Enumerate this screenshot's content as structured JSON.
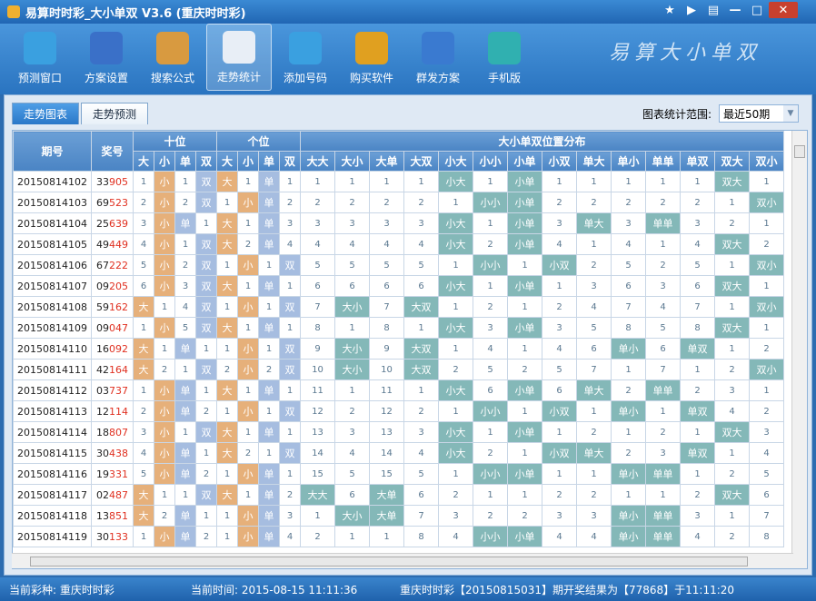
{
  "window": {
    "title": "易算时时彩_大小单双 V3.6 (重庆时时彩)"
  },
  "toolbar": {
    "items": [
      {
        "label": "预测窗口",
        "icon": "cloud-icon",
        "color": "#3aa0e0"
      },
      {
        "label": "方案设置",
        "icon": "settings-panel-icon",
        "color": "#3a70c8"
      },
      {
        "label": "搜索公式",
        "icon": "search-doc-icon",
        "color": "#d89a40"
      },
      {
        "label": "走势统计",
        "icon": "trend-chart-icon",
        "color": "#e8eef6"
      },
      {
        "label": "添加号码",
        "icon": "folder-add-icon",
        "color": "#3aa0e0"
      },
      {
        "label": "购买软件",
        "icon": "key-icon",
        "color": "#e0a020"
      },
      {
        "label": "群发方案",
        "icon": "users-icon",
        "color": "#3a7ad0"
      },
      {
        "label": "手机版",
        "icon": "mobile-icon",
        "color": "#30b0b0"
      }
    ],
    "brand": "易算大小单双"
  },
  "tabs": [
    "走势图表",
    "走势预测"
  ],
  "range": {
    "label": "图表统计范围:",
    "value": "最近50期"
  },
  "table": {
    "headers": {
      "period": "期号",
      "number": "奖号",
      "tens": "十位",
      "units": "个位",
      "dist": "大小单双位置分布"
    },
    "sub": [
      "大",
      "小",
      "单",
      "双",
      "大",
      "小",
      "单",
      "双"
    ],
    "dist_cols": [
      "大大",
      "大小",
      "大单",
      "大双",
      "小大",
      "小小",
      "小单",
      "小双",
      "单大",
      "单小",
      "单单",
      "单双",
      "双大",
      "双小"
    ],
    "rows": [
      {
        "p": "20150814102",
        "n": "33905",
        "t": [
          "1",
          "小",
          "1",
          "双"
        ],
        "u": [
          "大",
          "1",
          "单",
          "1"
        ],
        "d": [
          "1",
          "1",
          "1",
          "1",
          "小大",
          "1",
          "小单",
          "1",
          "1",
          "1",
          "1",
          "1",
          "双大",
          "1"
        ]
      },
      {
        "p": "20150814103",
        "n": "69523",
        "t": [
          "2",
          "小",
          "2",
          "双"
        ],
        "u": [
          "1",
          "小",
          "单",
          "2"
        ],
        "d": [
          "2",
          "2",
          "2",
          "2",
          "1",
          "小小",
          "小单",
          "2",
          "2",
          "2",
          "2",
          "2",
          "1",
          "双小"
        ]
      },
      {
        "p": "20150814104",
        "n": "25639",
        "t": [
          "3",
          "小",
          "单",
          "1"
        ],
        "u": [
          "大",
          "1",
          "单",
          "3"
        ],
        "d": [
          "3",
          "3",
          "3",
          "3",
          "小大",
          "1",
          "小单",
          "3",
          "单大",
          "3",
          "单单",
          "3",
          "2",
          "1"
        ]
      },
      {
        "p": "20150814105",
        "n": "49449",
        "t": [
          "4",
          "小",
          "1",
          "双"
        ],
        "u": [
          "大",
          "2",
          "单",
          "4"
        ],
        "d": [
          "4",
          "4",
          "4",
          "4",
          "小大",
          "2",
          "小单",
          "4",
          "1",
          "4",
          "1",
          "4",
          "双大",
          "2"
        ]
      },
      {
        "p": "20150814106",
        "n": "67222",
        "t": [
          "5",
          "小",
          "2",
          "双"
        ],
        "u": [
          "1",
          "小",
          "1",
          "双"
        ],
        "d": [
          "5",
          "5",
          "5",
          "5",
          "1",
          "小小",
          "1",
          "小双",
          "2",
          "5",
          "2",
          "5",
          "1",
          "双小"
        ]
      },
      {
        "p": "20150814107",
        "n": "09205",
        "t": [
          "6",
          "小",
          "3",
          "双"
        ],
        "u": [
          "大",
          "1",
          "单",
          "1"
        ],
        "d": [
          "6",
          "6",
          "6",
          "6",
          "小大",
          "1",
          "小单",
          "1",
          "3",
          "6",
          "3",
          "6",
          "双大",
          "1"
        ]
      },
      {
        "p": "20150814108",
        "n": "59162",
        "t": [
          "大",
          "1",
          "4",
          "双"
        ],
        "u": [
          "1",
          "小",
          "1",
          "双"
        ],
        "d": [
          "7",
          "大小",
          "7",
          "大双",
          "1",
          "2",
          "1",
          "2",
          "4",
          "7",
          "4",
          "7",
          "1",
          "双小"
        ]
      },
      {
        "p": "20150814109",
        "n": "09047",
        "t": [
          "1",
          "小",
          "5",
          "双"
        ],
        "u": [
          "大",
          "1",
          "单",
          "1"
        ],
        "d": [
          "8",
          "1",
          "8",
          "1",
          "小大",
          "3",
          "小单",
          "3",
          "5",
          "8",
          "5",
          "8",
          "双大",
          "1"
        ]
      },
      {
        "p": "20150814110",
        "n": "16092",
        "t": [
          "大",
          "1",
          "单",
          "1"
        ],
        "u": [
          "1",
          "小",
          "1",
          "双"
        ],
        "d": [
          "9",
          "大小",
          "9",
          "大双",
          "1",
          "4",
          "1",
          "4",
          "6",
          "单小",
          "6",
          "单双",
          "1",
          "2"
        ]
      },
      {
        "p": "20150814111",
        "n": "42164",
        "t": [
          "大",
          "2",
          "1",
          "双"
        ],
        "u": [
          "2",
          "小",
          "2",
          "双"
        ],
        "d": [
          "10",
          "大小",
          "10",
          "大双",
          "2",
          "5",
          "2",
          "5",
          "7",
          "1",
          "7",
          "1",
          "2",
          "双小"
        ]
      },
      {
        "p": "20150814112",
        "n": "03737",
        "t": [
          "1",
          "小",
          "单",
          "1"
        ],
        "u": [
          "大",
          "1",
          "单",
          "1"
        ],
        "d": [
          "11",
          "1",
          "11",
          "1",
          "小大",
          "6",
          "小单",
          "6",
          "单大",
          "2",
          "单单",
          "2",
          "3",
          "1"
        ]
      },
      {
        "p": "20150814113",
        "n": "12114",
        "t": [
          "2",
          "小",
          "单",
          "2"
        ],
        "u": [
          "1",
          "小",
          "1",
          "双"
        ],
        "d": [
          "12",
          "2",
          "12",
          "2",
          "1",
          "小小",
          "1",
          "小双",
          "1",
          "单小",
          "1",
          "单双",
          "4",
          "2"
        ]
      },
      {
        "p": "20150814114",
        "n": "18807",
        "t": [
          "3",
          "小",
          "1",
          "双"
        ],
        "u": [
          "大",
          "1",
          "单",
          "1"
        ],
        "d": [
          "13",
          "3",
          "13",
          "3",
          "小大",
          "1",
          "小单",
          "1",
          "2",
          "1",
          "2",
          "1",
          "双大",
          "3"
        ]
      },
      {
        "p": "20150814115",
        "n": "30438",
        "t": [
          "4",
          "小",
          "单",
          "1"
        ],
        "u": [
          "大",
          "2",
          "1",
          "双"
        ],
        "d": [
          "14",
          "4",
          "14",
          "4",
          "小大",
          "2",
          "1",
          "小双",
          "单大",
          "2",
          "3",
          "单双",
          "1",
          "4"
        ]
      },
      {
        "p": "20150814116",
        "n": "19331",
        "t": [
          "5",
          "小",
          "单",
          "2"
        ],
        "u": [
          "1",
          "小",
          "单",
          "1"
        ],
        "d": [
          "15",
          "5",
          "15",
          "5",
          "1",
          "小小",
          "小单",
          "1",
          "1",
          "单小",
          "单单",
          "1",
          "2",
          "5"
        ]
      },
      {
        "p": "20150814117",
        "n": "02487",
        "t": [
          "大",
          "1",
          "1",
          "双"
        ],
        "u": [
          "大",
          "1",
          "单",
          "2"
        ],
        "d": [
          "大大",
          "6",
          "大单",
          "6",
          "2",
          "1",
          "1",
          "2",
          "2",
          "1",
          "1",
          "2",
          "双大",
          "6"
        ]
      },
      {
        "p": "20150814118",
        "n": "13851",
        "t": [
          "大",
          "2",
          "单",
          "1"
        ],
        "u": [
          "1",
          "小",
          "单",
          "3"
        ],
        "d": [
          "1",
          "大小",
          "大单",
          "7",
          "3",
          "2",
          "2",
          "3",
          "3",
          "单小",
          "单单",
          "3",
          "1",
          "7"
        ]
      },
      {
        "p": "20150814119",
        "n": "30133",
        "t": [
          "1",
          "小",
          "单",
          "2"
        ],
        "u": [
          "1",
          "小",
          "单",
          "4"
        ],
        "d": [
          "2",
          "1",
          "1",
          "8",
          "4",
          "小小",
          "小单",
          "4",
          "4",
          "单小",
          "单单",
          "4",
          "2",
          "8"
        ]
      }
    ]
  },
  "status": {
    "lottery": "当前彩种: 重庆时时彩",
    "time": "当前时间: 2015-08-15 11:11:36",
    "result": "重庆时时彩【20150815031】期开奖结果为【77868】于11:11:20"
  }
}
